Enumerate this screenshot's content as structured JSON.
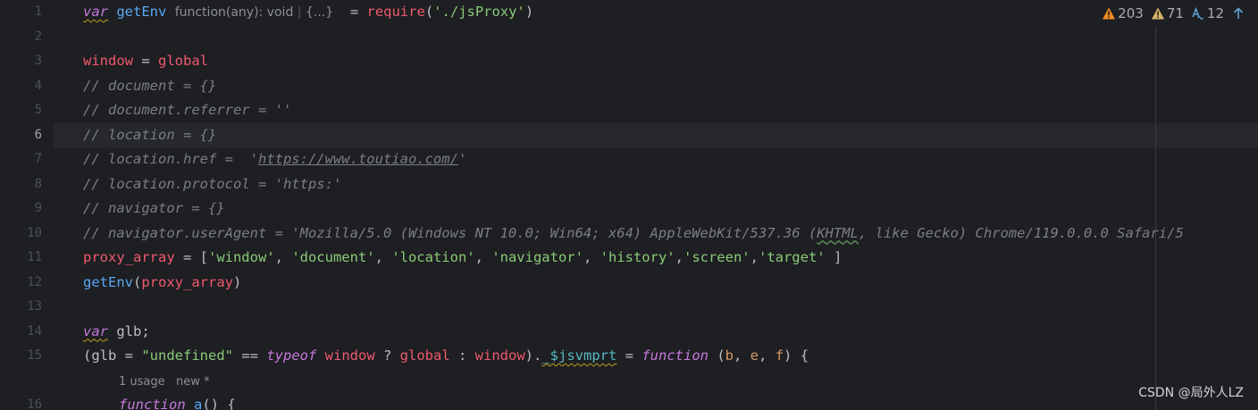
{
  "gutter": {
    "line_numbers": [
      "1",
      "2",
      "3",
      "4",
      "5",
      "6",
      "7",
      "8",
      "9",
      "10",
      "11",
      "12",
      "13",
      "14",
      "15",
      "16"
    ],
    "current_line": "6"
  },
  "code": {
    "l1": {
      "kw": "var",
      "name": "getEnv",
      "hint_type": "function(any): void",
      "hint_collapsed": "{...}",
      "eq": " = ",
      "require": "require",
      "open": "(",
      "path": "'./jsProxy'",
      "close": ")"
    },
    "l3": {
      "window": "window",
      "eq": " = ",
      "global": "global"
    },
    "l4": "// document = {}",
    "l5": "// document.referrer = ''",
    "l6": "// location = {}",
    "l7_pre": "// location.href =  '",
    "l7_url": "https://www.toutiao.com/",
    "l7_post": "'",
    "l8": "// location.protocol = 'https:'",
    "l9": "// navigator = {}",
    "l10_pre": "// navigator.userAgent = 'Mozilla/5.0 (Windows NT 10.0; Win64; x64) AppleWebKit/537.36 (",
    "l10_khtml": "KHTML",
    "l10_post": ", like Gecko) Chrome/119.0.0.0 Safari/5",
    "l11": {
      "name": "proxy_array",
      "eq": " = [",
      "s1": "'window'",
      "s2": "'document'",
      "s3": "'location'",
      "s4": "'navigator'",
      "s5": "'history'",
      "s6": "'screen'",
      "s7": "'target'",
      "end": " ]"
    },
    "l12": {
      "fn": "getEnv",
      "open": "(",
      "arg": "proxy_array",
      "close": ")"
    },
    "l14": {
      "kw": "var",
      "rest": " glb;"
    },
    "l15": {
      "open": "(glb = ",
      "str": "\"undefined\"",
      "eq": " == ",
      "typeof": "typeof",
      "window": "window",
      "q": " ? ",
      "global": "global",
      "colon": " : ",
      "window2": "window",
      "dot": ").",
      "prop": "_$jsvmprt",
      "assign": " = ",
      "function": "function",
      "params_open": " (",
      "b": "b",
      "e": "e",
      "f": "f",
      "params_close": ") {"
    },
    "inlay": {
      "usage": "1 usage",
      "new": "new *"
    },
    "l16": {
      "kw": "function",
      "name": "a",
      "rest": "() {"
    }
  },
  "status": {
    "errors": "203",
    "warnings": "71",
    "typos": "12"
  },
  "watermark": "CSDN @局外人LZ"
}
